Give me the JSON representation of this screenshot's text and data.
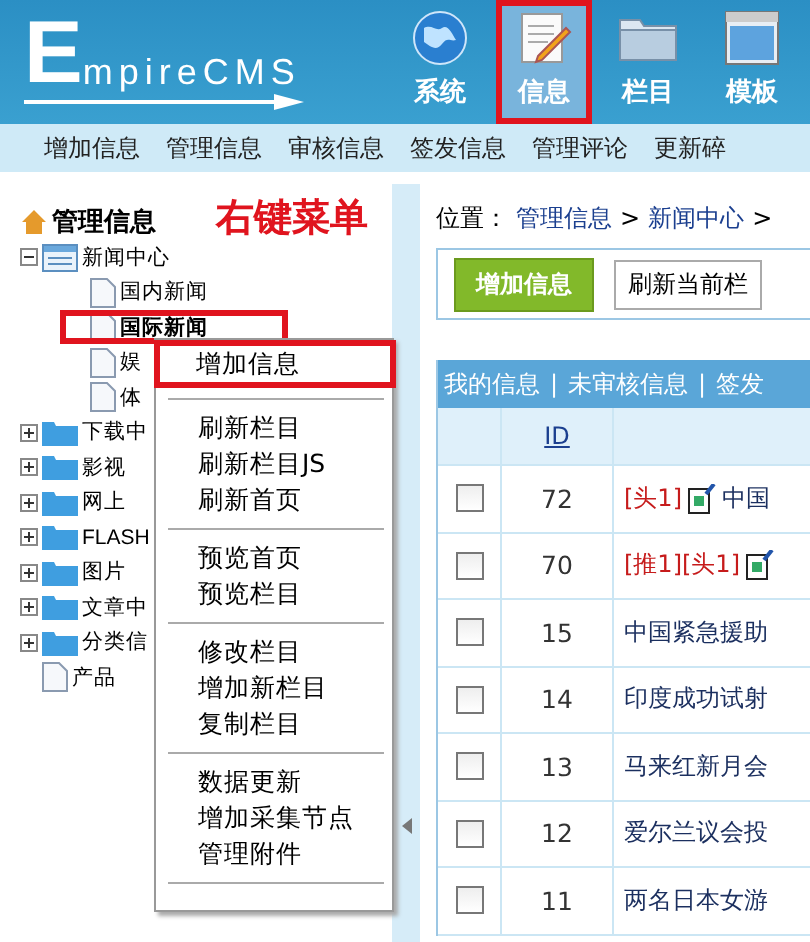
{
  "logo": {
    "initial": "E",
    "rest": "mpireCMS"
  },
  "top_nav": [
    {
      "label": "系统",
      "kind": "globe",
      "selected": false
    },
    {
      "label": "信息",
      "kind": "notepad",
      "selected": true
    },
    {
      "label": "栏目",
      "kind": "folder",
      "selected": false
    },
    {
      "label": "模板",
      "kind": "window",
      "selected": false
    }
  ],
  "sub_nav": [
    "增加信息",
    "管理信息",
    "审核信息",
    "签发信息",
    "管理评论",
    "更新碎"
  ],
  "sidebar": {
    "title": "管理信息",
    "annotation": "右键菜单",
    "tree": [
      {
        "label": "新闻中心",
        "kind": "list",
        "expanded": true,
        "highlighted": false,
        "children": [
          {
            "label": "国内新闻",
            "kind": "page",
            "highlighted": false
          },
          {
            "label": "国际新闻",
            "kind": "page",
            "highlighted": true
          },
          {
            "label": "娱",
            "kind": "page",
            "highlighted": false
          },
          {
            "label": "体",
            "kind": "page",
            "highlighted": false
          }
        ]
      },
      {
        "label": "下载中",
        "kind": "folder",
        "expanded": false,
        "highlighted": false
      },
      {
        "label": "影视",
        "kind": "folder",
        "expanded": false,
        "highlighted": false
      },
      {
        "label": "网上",
        "kind": "folder",
        "expanded": false,
        "highlighted": false
      },
      {
        "label": "FLASH",
        "kind": "folder",
        "expanded": false,
        "highlighted": false
      },
      {
        "label": "图片",
        "kind": "folder",
        "expanded": false,
        "highlighted": false
      },
      {
        "label": "文章中",
        "kind": "folder",
        "expanded": false,
        "highlighted": false
      },
      {
        "label": "分类信",
        "kind": "folder",
        "expanded": false,
        "highlighted": false
      },
      {
        "label": "产品",
        "kind": "page",
        "highlighted": false
      }
    ]
  },
  "context_menu": [
    [
      {
        "label": "增加信息",
        "highlighted": true
      }
    ],
    [
      {
        "label": "刷新栏目",
        "highlighted": false
      },
      {
        "label": "刷新栏目JS",
        "highlighted": false
      },
      {
        "label": "刷新首页",
        "highlighted": false
      }
    ],
    [
      {
        "label": "预览首页",
        "highlighted": false
      },
      {
        "label": "预览栏目",
        "highlighted": false
      }
    ],
    [
      {
        "label": "修改栏目",
        "highlighted": false
      },
      {
        "label": "增加新栏目",
        "highlighted": false
      },
      {
        "label": "复制栏目",
        "highlighted": false
      }
    ],
    [
      {
        "label": "数据更新",
        "highlighted": false
      },
      {
        "label": "增加采集节点",
        "highlighted": false
      },
      {
        "label": "管理附件",
        "highlighted": false
      }
    ]
  ],
  "breadcrumb": {
    "label": "位置：",
    "separator": ">",
    "parts": [
      "管理信息",
      "新闻中心"
    ]
  },
  "toolbar": {
    "primary": "增加信息",
    "secondary": "刷新当前栏"
  },
  "table": {
    "tabs": [
      "我的信息",
      "未审核信息",
      "签发"
    ],
    "tab_separator": "|",
    "id_header": "ID",
    "rows": [
      {
        "checked": false,
        "id": "72",
        "tags": "[头1]",
        "icon": true,
        "title": "中国"
      },
      {
        "checked": false,
        "id": "70",
        "tags": "[推1][头1]",
        "icon": true
      },
      {
        "checked": false,
        "id": "15",
        "title": "中国紧急援助"
      },
      {
        "checked": false,
        "id": "14",
        "title": "印度成功试射"
      },
      {
        "checked": false,
        "id": "13",
        "title": "马来红新月会"
      },
      {
        "checked": false,
        "id": "12",
        "title": "爱尔兰议会投"
      },
      {
        "checked": false,
        "id": "11",
        "title": "两名日本女游"
      }
    ]
  }
}
